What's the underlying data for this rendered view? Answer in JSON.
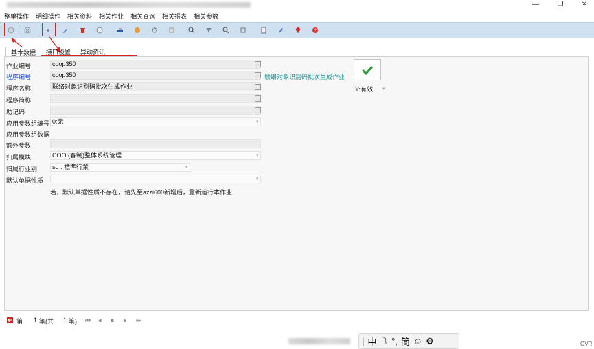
{
  "menu": [
    "整单操作",
    "明细操作",
    "相关资料",
    "相关作业",
    "相关查询",
    "相关报表",
    "相关参数"
  ],
  "window_controls": [
    "—",
    "❐",
    "✕"
  ],
  "tabs": [
    "基本数据",
    "接口设置",
    "异动资讯"
  ],
  "form": {
    "job_no": {
      "label": "作业编号",
      "value": "coop350"
    },
    "prog_no": {
      "label": "程序编号",
      "value": "coop350"
    },
    "prog_name": {
      "label": "程序名称",
      "value": "联络对象识别码批次生成作业"
    },
    "prog_short": {
      "label": "程序简称",
      "value": ""
    },
    "mnemonic": {
      "label": "助记码",
      "value": ""
    },
    "param_group_no": {
      "label": "应用参数组编号",
      "value": "0:无"
    },
    "param_group_data": {
      "label": "应用参数组数据",
      "value": ""
    },
    "extra_param": {
      "label": "额外参数",
      "value": ""
    },
    "module": {
      "label": "归属模块",
      "value": "COO:(客制)整体系统管理"
    },
    "industry": {
      "label": "归属行业别",
      "value": "sd : 標準行業"
    },
    "default_doc_type": {
      "label": "默认单据性质",
      "value": ""
    }
  },
  "note": "若，默认单据性质不存在，请先至azzi600新增后，重新运行本作业",
  "assoc_link": "联络对象识别码批次生成作业",
  "status_value": "Y:有效",
  "nav": {
    "label": "第",
    "current": "1",
    "unit_of_total": "笔(共",
    "total": "1",
    "unit_close": "笔)"
  },
  "ime": {
    "cursor": "|",
    "mode": "中",
    "moon": "☽",
    "punct": "°,",
    "charset": "简",
    "emoji": "☺",
    "settings": "⚙"
  },
  "ovr": "OVR",
  "colors": {
    "toolbar": "#cfe0f0",
    "highlight": "#d9231f",
    "link": "#1a4fd6",
    "assoc": "#1c8c8c",
    "check": "#2e9c3a"
  }
}
